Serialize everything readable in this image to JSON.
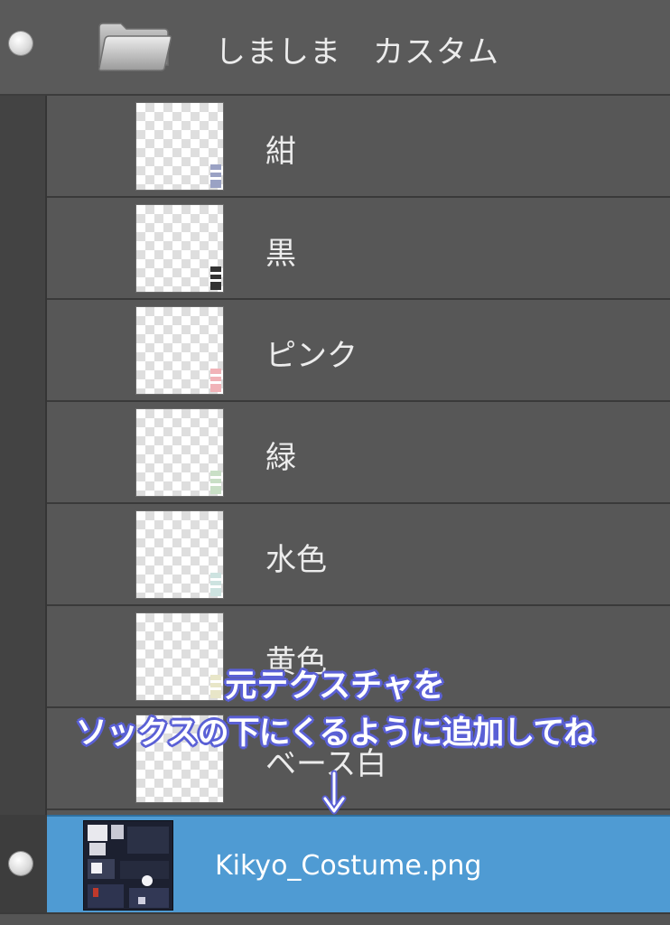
{
  "folder": {
    "name": "しましま　カスタム",
    "icon": "folder-icon"
  },
  "layers": [
    {
      "name": "紺",
      "accent": "#9aa2c4"
    },
    {
      "name": "黒",
      "accent": "#333333"
    },
    {
      "name": "ピンク",
      "accent": "#f1b3b8"
    },
    {
      "name": "緑",
      "accent": "#c9dfc6"
    },
    {
      "name": "水色",
      "accent": "#cde3e0"
    },
    {
      "name": "黄色",
      "accent": "#e8e6c8"
    },
    {
      "name": "ベース白",
      "accent": "#f4f4f4"
    }
  ],
  "selected_layer": {
    "name": "Kikyo_Costume.png"
  },
  "annotation": {
    "line1": "元テクスチャを",
    "line2": "ソックスの下にくるように追加してね"
  },
  "colors": {
    "panel_bg": "#575757",
    "selected_bg": "#4f9bd3",
    "annotation_outline": "#5a60d6"
  }
}
